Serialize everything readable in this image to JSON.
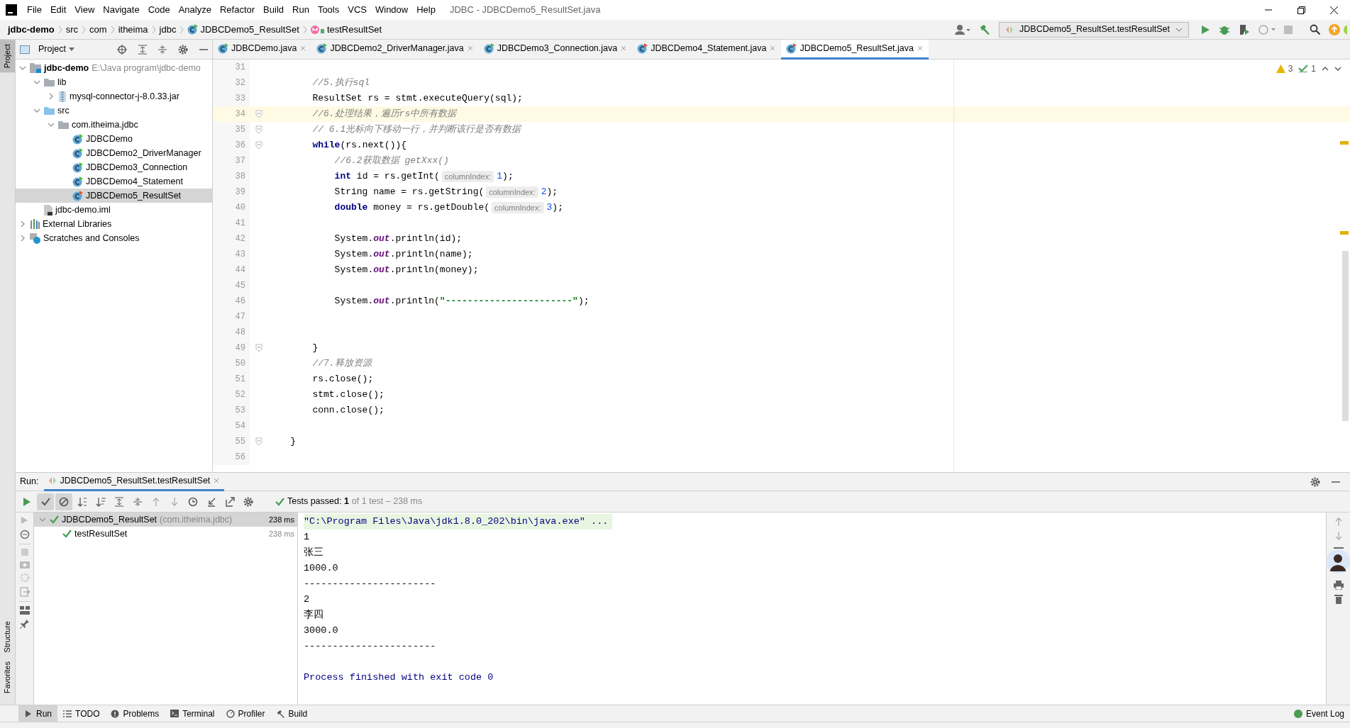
{
  "window": {
    "title": "JDBC - JDBCDemo5_ResultSet.java"
  },
  "menu": [
    "File",
    "Edit",
    "View",
    "Navigate",
    "Code",
    "Analyze",
    "Refactor",
    "Build",
    "Run",
    "Tools",
    "VCS",
    "Window",
    "Help"
  ],
  "breadcrumb": [
    {
      "label": "jdbc-demo",
      "kind": "project"
    },
    {
      "label": "src",
      "kind": "folder"
    },
    {
      "label": "com",
      "kind": "folder"
    },
    {
      "label": "itheima",
      "kind": "folder"
    },
    {
      "label": "jdbc",
      "kind": "folder"
    },
    {
      "label": "JDBCDemo5_ResultSet",
      "kind": "class"
    },
    {
      "label": "testResultSet",
      "kind": "method"
    }
  ],
  "run_config": "JDBCDemo5_ResultSet.testResultSet",
  "side_strip": [
    {
      "label": "Project",
      "selected": true
    },
    {
      "label": "Structure",
      "selected": false
    },
    {
      "label": "Favorites",
      "selected": false
    }
  ],
  "project_panel": {
    "title": "Project",
    "tree": [
      {
        "label": "jdbc-demo",
        "kind": "module",
        "hint": "E:\\Java program\\jdbc-demo",
        "expanded": true,
        "selected": false,
        "children": [
          {
            "label": "lib",
            "kind": "folder",
            "expanded": true,
            "selected": false,
            "children": [
              {
                "label": "mysql-connector-j-8.0.33.jar",
                "kind": "jar",
                "expanded": false,
                "selected": false
              }
            ]
          },
          {
            "label": "src",
            "kind": "source",
            "expanded": true,
            "selected": false,
            "children": [
              {
                "label": "com.itheima.jdbc",
                "kind": "package",
                "expanded": true,
                "selected": false,
                "children": [
                  {
                    "label": "JDBCDemo",
                    "kind": "class",
                    "selected": false
                  },
                  {
                    "label": "JDBCDemo2_DriverManager",
                    "kind": "class",
                    "selected": false
                  },
                  {
                    "label": "JDBCDemo3_Connection",
                    "kind": "class",
                    "selected": false
                  },
                  {
                    "label": "JDBCDemo4_Statement",
                    "kind": "class",
                    "selected": false
                  },
                  {
                    "label": "JDBCDemo5_ResultSet",
                    "kind": "class",
                    "selected": true
                  }
                ]
              }
            ]
          },
          {
            "label": "jdbc-demo.iml",
            "kind": "file",
            "selected": false
          }
        ]
      },
      {
        "label": "External Libraries",
        "kind": "libraries",
        "expanded": false,
        "selected": false
      },
      {
        "label": "Scratches and Consoles",
        "kind": "scratches",
        "expanded": false,
        "selected": false
      }
    ]
  },
  "tabs": [
    {
      "label": "JDBCDemo.java",
      "selected": false
    },
    {
      "label": "JDBCDemo2_DriverManager.java",
      "selected": false
    },
    {
      "label": "JDBCDemo3_Connection.java",
      "selected": false
    },
    {
      "label": "JDBCDemo4_Statement.java",
      "selected": false
    },
    {
      "label": "JDBCDemo5_ResultSet.java",
      "selected": true
    }
  ],
  "inspections": {
    "warnings": "3",
    "checks": "1"
  },
  "editor_lines": [
    {
      "number": "31",
      "current": false,
      "fold": false
    },
    {
      "number": "32",
      "current": false,
      "fold": false,
      "tokens": [
        {
          "kind": "comment",
          "text": "        //5.执行sql"
        }
      ]
    },
    {
      "number": "33",
      "current": false,
      "fold": false,
      "tokens": [
        {
          "kind": "code",
          "text": "        ResultSet rs = stmt.executeQuery(sql);"
        }
      ]
    },
    {
      "number": "34",
      "current": true,
      "fold": true,
      "tokens": [
        {
          "kind": "comment",
          "text": "        //6.处理结果，遍历rs中所有数据"
        }
      ]
    },
    {
      "number": "35",
      "current": false,
      "fold": true,
      "tokens": [
        {
          "kind": "comment",
          "text": "        // 6.1光标向下移动一行，并判断该行是否有数据"
        }
      ]
    },
    {
      "number": "36",
      "current": false,
      "fold": true,
      "tokens": [
        {
          "kind": "keyword",
          "text": "        while"
        },
        {
          "kind": "code",
          "text": "(rs.next()){"
        }
      ]
    },
    {
      "number": "37",
      "current": false,
      "fold": false,
      "tokens": [
        {
          "kind": "comment",
          "text": "            //6.2获取数据 getXxx()"
        }
      ]
    },
    {
      "number": "38",
      "current": false,
      "fold": false,
      "tokens": [
        {
          "kind": "keyword",
          "text": "            int"
        },
        {
          "kind": "code",
          "text": " id = rs.getInt("
        },
        {
          "kind": "hint",
          "text": "columnIndex:"
        },
        {
          "kind": "number",
          "text": "1"
        },
        {
          "kind": "code",
          "text": ");"
        }
      ]
    },
    {
      "number": "39",
      "current": false,
      "fold": false,
      "tokens": [
        {
          "kind": "code",
          "text": "            String name = rs.getString("
        },
        {
          "kind": "hint",
          "text": "columnIndex:"
        },
        {
          "kind": "number",
          "text": "2"
        },
        {
          "kind": "code",
          "text": ");"
        }
      ]
    },
    {
      "number": "40",
      "current": false,
      "fold": false,
      "tokens": [
        {
          "kind": "keyword",
          "text": "            double"
        },
        {
          "kind": "code",
          "text": " money = rs.getDouble("
        },
        {
          "kind": "hint",
          "text": "columnIndex:"
        },
        {
          "kind": "number",
          "text": "3"
        },
        {
          "kind": "code",
          "text": ");"
        }
      ]
    },
    {
      "number": "41",
      "current": false,
      "fold": false
    },
    {
      "number": "42",
      "current": false,
      "fold": false,
      "tokens": [
        {
          "kind": "code",
          "text": "            System."
        },
        {
          "kind": "field",
          "text": "out"
        },
        {
          "kind": "code",
          "text": ".println(id);"
        }
      ]
    },
    {
      "number": "43",
      "current": false,
      "fold": false,
      "tokens": [
        {
          "kind": "code",
          "text": "            System."
        },
        {
          "kind": "field",
          "text": "out"
        },
        {
          "kind": "code",
          "text": ".println(name);"
        }
      ]
    },
    {
      "number": "44",
      "current": false,
      "fold": false,
      "tokens": [
        {
          "kind": "code",
          "text": "            System."
        },
        {
          "kind": "field",
          "text": "out"
        },
        {
          "kind": "code",
          "text": ".println(money);"
        }
      ]
    },
    {
      "number": "45",
      "current": false,
      "fold": false
    },
    {
      "number": "46",
      "current": false,
      "fold": false,
      "tokens": [
        {
          "kind": "code",
          "text": "            System."
        },
        {
          "kind": "field",
          "text": "out"
        },
        {
          "kind": "code",
          "text": ".println("
        },
        {
          "kind": "string",
          "text": "\"-----------------------\""
        },
        {
          "kind": "code",
          "text": ");"
        }
      ]
    },
    {
      "number": "47",
      "current": false,
      "fold": false
    },
    {
      "number": "48",
      "current": false,
      "fold": false
    },
    {
      "number": "49",
      "current": false,
      "fold": true,
      "tokens": [
        {
          "kind": "code",
          "text": "        }"
        }
      ]
    },
    {
      "number": "50",
      "current": false,
      "fold": false,
      "tokens": [
        {
          "kind": "comment",
          "text": "        //7.释放资源"
        }
      ]
    },
    {
      "number": "51",
      "current": false,
      "fold": false,
      "tokens": [
        {
          "kind": "code",
          "text": "        rs.close();"
        }
      ]
    },
    {
      "number": "52",
      "current": false,
      "fold": false,
      "tokens": [
        {
          "kind": "code",
          "text": "        stmt.close();"
        }
      ]
    },
    {
      "number": "53",
      "current": false,
      "fold": false,
      "tokens": [
        {
          "kind": "code",
          "text": "        conn.close();"
        }
      ]
    },
    {
      "number": "54",
      "current": false,
      "fold": false
    },
    {
      "number": "55",
      "current": false,
      "fold": true,
      "tokens": [
        {
          "kind": "code",
          "text": "    }"
        }
      ]
    },
    {
      "number": "56",
      "current": false,
      "fold": false
    }
  ],
  "run": {
    "label": "Run:",
    "tab": "JDBCDemo5_ResultSet.testResultSet",
    "toolbar": [
      {
        "kind": "show-passed",
        "on": true
      },
      {
        "kind": "show-ignored",
        "on": true
      },
      {
        "kind": "sort-alpha",
        "on": false
      },
      {
        "kind": "sort-duration",
        "on": false
      },
      {
        "kind": "expand",
        "on": false
      },
      {
        "kind": "collapse",
        "on": false
      },
      {
        "kind": "up",
        "on": false
      },
      {
        "kind": "down",
        "on": false
      },
      {
        "kind": "history",
        "on": false
      },
      {
        "kind": "import",
        "on": false
      },
      {
        "kind": "export",
        "on": false
      },
      {
        "kind": "settings",
        "on": false
      }
    ],
    "summary": "Tests passed: **1**",
    "summary_detail": "of 1 test – 238 ms",
    "tests": [
      {
        "name": "JDBCDemo5_ResultSet",
        "package": "(com.itheima.jdbc)",
        "time": "238 ms",
        "passed": true,
        "expanded": true,
        "selected": true,
        "children": [
          {
            "name": "testResultSet",
            "time": "238 ms",
            "passed": true,
            "selected": false
          }
        ]
      }
    ],
    "console": [
      {
        "kind": "command",
        "text": "\"C:\\Program Files\\Java\\jdk1.8.0_202\\bin\\java.exe\" ..."
      },
      {
        "kind": "output",
        "text": "1"
      },
      {
        "kind": "output",
        "text": "张三"
      },
      {
        "kind": "output",
        "text": "1000.0"
      },
      {
        "kind": "output",
        "text": "-----------------------"
      },
      {
        "kind": "output",
        "text": "2"
      },
      {
        "kind": "output",
        "text": "李四"
      },
      {
        "kind": "output",
        "text": "3000.0"
      },
      {
        "kind": "output",
        "text": "-----------------------"
      },
      {
        "kind": "blank"
      },
      {
        "kind": "exit",
        "text": "Process finished with exit code 0"
      }
    ]
  },
  "tool_windows": [
    {
      "label": "Run",
      "kind": "run",
      "selected": true
    },
    {
      "label": "TODO",
      "kind": "todo",
      "selected": false
    },
    {
      "label": "Problems",
      "kind": "problems",
      "selected": false
    },
    {
      "label": "Terminal",
      "kind": "terminal",
      "selected": false
    },
    {
      "label": "Profiler",
      "kind": "profiler",
      "selected": false
    },
    {
      "label": "Build",
      "kind": "build",
      "selected": false
    }
  ],
  "event_log": "Event Log"
}
